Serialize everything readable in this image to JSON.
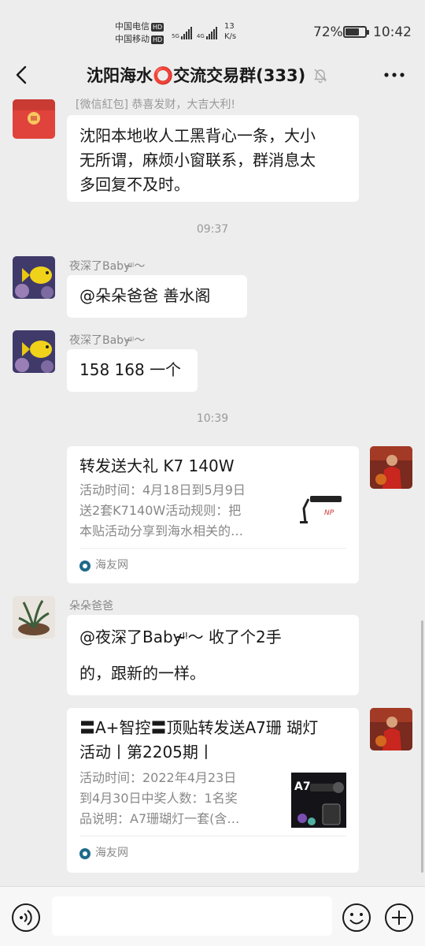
{
  "status_bar": {
    "carrier1": "中国电信",
    "carrier2": "中国移动",
    "hd": "HD",
    "net1": "5G",
    "net2": "4G",
    "speed_value": "13",
    "speed_unit": "K/s",
    "battery": "72%",
    "battery_level": 0.72,
    "time": "10:42"
  },
  "nav": {
    "title": "沈阳海水⭕交流交易群(333)"
  },
  "messages": {
    "m1_redpacket": "[微信紅包] 恭喜发财，大吉大利!",
    "m1_text_1": "沈阳本地收人工黑背心一条，大小",
    "m1_text_2": "无所谓，麻烦小窗联系，群消息太",
    "m1_text_3": "多回复不及时。",
    "time1": "09:37",
    "m2_sender": "夜深了Baby",
    "m2_text": "@朵朵爸爸  善水阁",
    "m3_sender": "夜深了Baby",
    "m3_text": "158 168 一个",
    "time2": "10:39",
    "card1_title": "转发送大礼 K7 140W",
    "card1_desc_1": "活动时间：4月18日到5月9日",
    "card1_desc_2": "送2套K7140W活动规则：把",
    "card1_desc_3": "本贴活动分享到海水相关的…",
    "card1_source": "海友网",
    "m5_sender": "朵朵爸爸",
    "m5_text_1": "@夜深了Baby",
    "m5_text_2": " 收了个2手",
    "m5_text_3": "的，跟新的一样。",
    "card2_title_1": "〓A+智控〓顶贴转发送A7珊 瑚灯",
    "card2_title_2": "活动丨第2205期丨",
    "card2_desc_1": "活动时间：2022年4月23日",
    "card2_desc_2": "到4月30日中奖人数：1名奖",
    "card2_desc_3": "品说明：A7珊瑚灯一套(含…",
    "card2_source": "海友网",
    "card2_thumb_label": "A7"
  },
  "icons": {
    "back": "chevron-left-icon",
    "mute": "bell-off-icon",
    "more": "more-icon",
    "voice": "voice-icon",
    "emoji": "emoji-icon",
    "plus": "plus-icon"
  }
}
